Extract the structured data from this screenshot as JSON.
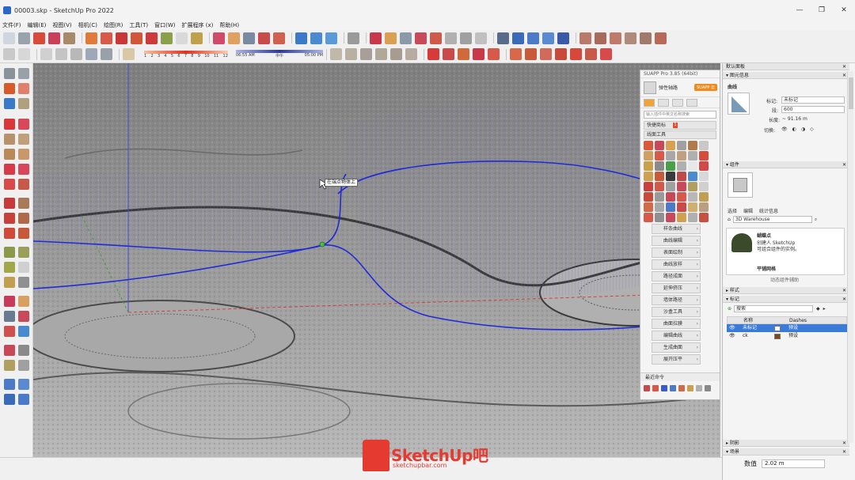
{
  "window": {
    "title": "00003.skp - SketchUp Pro 2022",
    "minimize": "—",
    "maximize": "❐",
    "close": "✕"
  },
  "menu": [
    "文件(F)",
    "编辑(E)",
    "视图(V)",
    "相机(C)",
    "绘图(R)",
    "工具(T)",
    "窗口(W)",
    "扩展程序 (x)",
    "帮助(H)"
  ],
  "shadow": {
    "scale_numbers": [
      "1",
      "2",
      "3",
      "4",
      "5",
      "6",
      "7",
      "8",
      "9",
      "10",
      "11",
      "12"
    ],
    "time_left": "06:55 AM",
    "time_mid": "中午",
    "time_right": "05:00 PM"
  },
  "viewport": {
    "tooltip": "在端点物体上"
  },
  "suapp": {
    "header": "SUAPP Pro 3.85 (64bit)",
    "user": "弹性轴路",
    "badge": "SUAPP 云",
    "search_placeholder": "输入插件中英文名称搜索",
    "quick": "快捷商标",
    "quick_num": "1",
    "section": "线面工具",
    "commands": [
      "样条曲线",
      "曲线编辑",
      "表面绘制",
      "曲线放样",
      "路径成面",
      "延伸挤压",
      "墙体路径",
      "沙盒工具",
      "曲面拉膜",
      "编辑曲线",
      "生成曲面",
      "展开压平"
    ],
    "recent": "最近命令"
  },
  "tray": {
    "title": "默认面板",
    "entity_info": "图元信息",
    "entity_type": "曲线",
    "tag_label": "标记:",
    "tag_value": "未标记",
    "segments_label": "段:",
    "segments_value": "600",
    "length_label": "长度:",
    "length_value": "~ 91.16 m",
    "toggle_label": "切换:",
    "components": "组件",
    "comp_tabs": [
      "选择",
      "编辑",
      "统计信息"
    ],
    "warehouse": "3D Warehouse",
    "comp_name": "蝴蝶点",
    "comp_desc1": "创建人 SketchUp",
    "comp_desc2": "可组合组件的实例。",
    "comp_name2": "平铺网格",
    "comp_footer": "动态组件辅助",
    "styles": "样式",
    "tags": "标记",
    "tag_search": "搜索",
    "table_headers": [
      "名称",
      "Dashes"
    ],
    "tag_rows": [
      {
        "name": "未标记",
        "dash": "预设",
        "color": "#ffffff"
      },
      {
        "name": "ck",
        "dash": "预设",
        "color": "#7a4a10"
      }
    ],
    "shadows": "阴影",
    "scenes": "场景"
  },
  "status": {
    "measure_label": "数值",
    "measure_value": "2.02 m"
  },
  "logo": {
    "text": "SketchUp吧",
    "url": "sketchupbar.com"
  },
  "colors": {
    "accent_orange": "#f3a23a",
    "selection_blue": "#3b7bd8",
    "curve_blue": "#1f2ad8",
    "brand_red": "#e53a2f"
  }
}
